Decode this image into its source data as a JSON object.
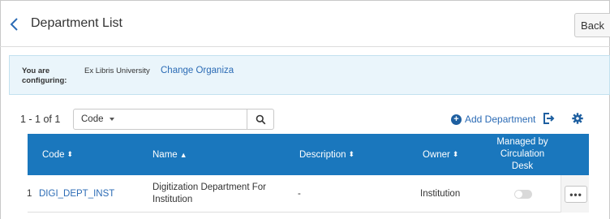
{
  "header": {
    "title": "Department List",
    "back_label": "Back"
  },
  "config": {
    "label": "You are configuring:",
    "organization": "Ex Libris University",
    "change_link": "Change Organiza"
  },
  "toolbar": {
    "count": "1 - 1 of 1",
    "filter_field": "Code",
    "search_value": "",
    "add_label": "Add Department"
  },
  "table": {
    "headers": {
      "code": "Code",
      "name": "Name",
      "description": "Description",
      "owner": "Owner",
      "managed_line1": "Managed by",
      "managed_line2": "Circulation",
      "managed_line3": "Desk"
    },
    "sort_both": "⬍",
    "sort_up": "▲",
    "rows": [
      {
        "num": "1",
        "code": "DIGI_DEPT_INST",
        "name_line1": "Digitization Department For",
        "name_line2": "Institution",
        "description": "-",
        "owner": "Institution",
        "managed_by_circ_desk": false,
        "actions": "•••"
      }
    ]
  },
  "colors": {
    "header_bg": "#1a77bd",
    "link": "#2b6bb5",
    "config_bg": "#eaf5fb"
  }
}
